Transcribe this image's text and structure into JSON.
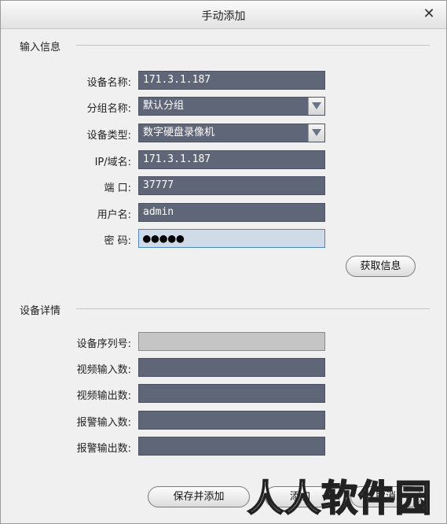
{
  "window": {
    "title": "手动添加"
  },
  "sections": {
    "input_info": "输入信息",
    "device_details": "设备详情"
  },
  "fields": {
    "device_name": {
      "label": "设备名称:",
      "value": "171.3.1.187"
    },
    "group_name": {
      "label": "分组名称:",
      "value": "默认分组"
    },
    "device_type": {
      "label": "设备类型:",
      "value": "数字硬盘录像机"
    },
    "ip_domain": {
      "label": "IP/域名:",
      "value": "171.3.1.187"
    },
    "port": {
      "label": "端  口:",
      "value": "37777"
    },
    "username": {
      "label": "用户名:",
      "value": "admin"
    },
    "password": {
      "label": "密   码:",
      "value": "●●●●●"
    }
  },
  "details": {
    "serial": {
      "label": "设备序列号:",
      "value": ""
    },
    "video_in": {
      "label": "视频输入数:",
      "value": ""
    },
    "video_out": {
      "label": "视频输出数:",
      "value": ""
    },
    "alarm_in": {
      "label": "报警输入数:",
      "value": ""
    },
    "alarm_out": {
      "label": "报警输出数:",
      "value": ""
    }
  },
  "buttons": {
    "get_info": "获取信息",
    "save_add": "保存并添加",
    "add": "添加",
    "cancel": "取消"
  },
  "watermark": "人人软件园",
  "icons": {
    "close": "close-icon",
    "dropdown": "chevron-down-icon"
  }
}
